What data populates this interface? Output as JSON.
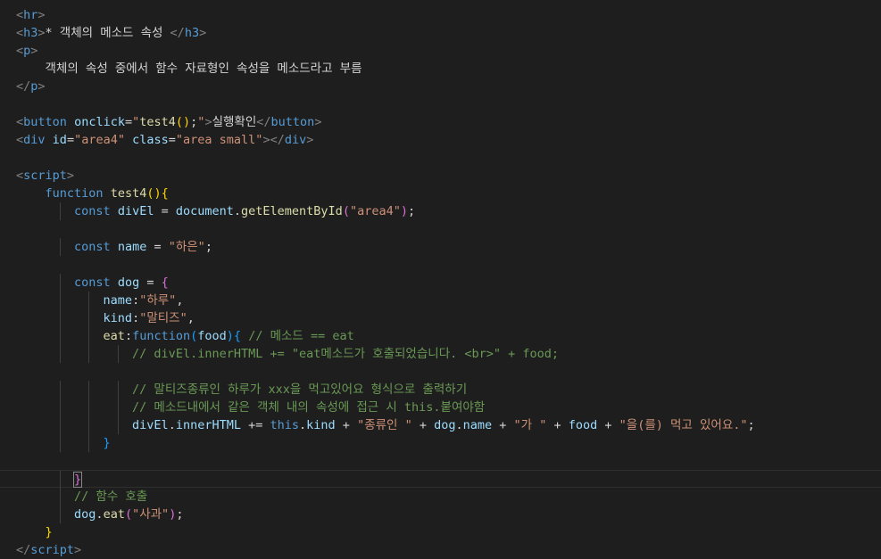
{
  "editor": {
    "lines": [
      [
        [
          "t",
          "<"
        ],
        [
          "tg",
          "hr"
        ],
        [
          "t",
          ">"
        ]
      ],
      [
        [
          "t",
          "<"
        ],
        [
          "tg",
          "h3"
        ],
        [
          "t",
          ">"
        ],
        [
          "tx",
          "* 객체의 메소드 속성 "
        ],
        [
          "t",
          "</"
        ],
        [
          "tg",
          "h3"
        ],
        [
          "t",
          ">"
        ]
      ],
      [
        [
          "t",
          "<"
        ],
        [
          "tg",
          "p"
        ],
        [
          "t",
          ">"
        ]
      ],
      [
        [
          "tx",
          "    객체의 속성 중에서 함수 자료형인 속성을 메소드라고 부름"
        ]
      ],
      [
        [
          "t",
          "</"
        ],
        [
          "tg",
          "p"
        ],
        [
          "t",
          ">"
        ]
      ],
      [],
      [
        [
          "t",
          "<"
        ],
        [
          "tg",
          "button"
        ],
        [
          "tx",
          " "
        ],
        [
          "at",
          "onclick"
        ],
        [
          "tx",
          "="
        ],
        [
          "st",
          "\""
        ],
        [
          "fn",
          "test4"
        ],
        [
          "br1",
          "()"
        ],
        [
          "tx",
          ";"
        ],
        [
          "st",
          "\""
        ],
        [
          "t",
          ">"
        ],
        [
          "tx",
          "실행확인"
        ],
        [
          "t",
          "</"
        ],
        [
          "tg",
          "button"
        ],
        [
          "t",
          ">"
        ]
      ],
      [
        [
          "t",
          "<"
        ],
        [
          "tg",
          "div"
        ],
        [
          "tx",
          " "
        ],
        [
          "at",
          "id"
        ],
        [
          "tx",
          "="
        ],
        [
          "st",
          "\"area4\""
        ],
        [
          "tx",
          " "
        ],
        [
          "at",
          "class"
        ],
        [
          "tx",
          "="
        ],
        [
          "st",
          "\"area small\""
        ],
        [
          "t",
          "></"
        ],
        [
          "tg",
          "div"
        ],
        [
          "t",
          ">"
        ]
      ],
      [],
      [
        [
          "t",
          "<"
        ],
        [
          "tg",
          "script"
        ],
        [
          "t",
          ">"
        ]
      ],
      [
        [
          "tx",
          "    "
        ],
        [
          "kw",
          "function"
        ],
        [
          "tx",
          " "
        ],
        [
          "fn",
          "test4"
        ],
        [
          "br1",
          "(){"
        ]
      ],
      [
        [
          "tx",
          "        "
        ],
        [
          "kw",
          "const"
        ],
        [
          "tx",
          " "
        ],
        [
          "vr",
          "divEl"
        ],
        [
          "tx",
          " = "
        ],
        [
          "vr",
          "document"
        ],
        [
          "tx",
          "."
        ],
        [
          "fn",
          "getElementById"
        ],
        [
          "br2",
          "("
        ],
        [
          "st",
          "\"area4\""
        ],
        [
          "br2",
          ")"
        ],
        [
          "tx",
          ";"
        ]
      ],
      [],
      [
        [
          "tx",
          "        "
        ],
        [
          "kw",
          "const"
        ],
        [
          "tx",
          " "
        ],
        [
          "vr",
          "name"
        ],
        [
          "tx",
          " = "
        ],
        [
          "st",
          "\"하은\""
        ],
        [
          "tx",
          ";"
        ]
      ],
      [],
      [
        [
          "tx",
          "        "
        ],
        [
          "kw",
          "const"
        ],
        [
          "tx",
          " "
        ],
        [
          "vr",
          "dog"
        ],
        [
          "tx",
          " = "
        ],
        [
          "br2",
          "{"
        ]
      ],
      [
        [
          "tx",
          "            "
        ],
        [
          "vr",
          "name"
        ],
        [
          "tx",
          ":"
        ],
        [
          "st",
          "\"하루\""
        ],
        [
          "tx",
          ","
        ]
      ],
      [
        [
          "tx",
          "            "
        ],
        [
          "vr",
          "kind"
        ],
        [
          "tx",
          ":"
        ],
        [
          "st",
          "\"말티즈\""
        ],
        [
          "tx",
          ","
        ]
      ],
      [
        [
          "tx",
          "            "
        ],
        [
          "fn",
          "eat"
        ],
        [
          "tx",
          ":"
        ],
        [
          "kw",
          "function"
        ],
        [
          "br3",
          "("
        ],
        [
          "vr",
          "food"
        ],
        [
          "br3",
          ")"
        ],
        [
          "br3",
          "{"
        ],
        [
          "tx",
          " "
        ],
        [
          "cm",
          "// 메소드 == eat"
        ]
      ],
      [
        [
          "tx",
          "                "
        ],
        [
          "cm",
          "// divEl.innerHTML += \"eat메소드가 호출되었습니다. <br>\" + food;"
        ]
      ],
      [],
      [
        [
          "tx",
          "                "
        ],
        [
          "cm",
          "// 말티즈종류인 하루가 xxx을 먹고있어요 형식으로 출력하기"
        ]
      ],
      [
        [
          "tx",
          "                "
        ],
        [
          "cm",
          "// 메소드내에서 같은 객체 내의 속성에 접근 시 this.붙여야함"
        ]
      ],
      [
        [
          "tx",
          "                "
        ],
        [
          "vr",
          "divEl"
        ],
        [
          "tx",
          "."
        ],
        [
          "vr",
          "innerHTML"
        ],
        [
          "tx",
          " += "
        ],
        [
          "kw",
          "this"
        ],
        [
          "tx",
          "."
        ],
        [
          "vr",
          "kind"
        ],
        [
          "tx",
          " + "
        ],
        [
          "st",
          "\"종류인 \""
        ],
        [
          "tx",
          " + "
        ],
        [
          "vr",
          "dog"
        ],
        [
          "tx",
          "."
        ],
        [
          "vr",
          "name"
        ],
        [
          "tx",
          " + "
        ],
        [
          "st",
          "\"가 \""
        ],
        [
          "tx",
          " + "
        ],
        [
          "vr",
          "food"
        ],
        [
          "tx",
          " + "
        ],
        [
          "st",
          "\"을(를) 먹고 있어요.\""
        ],
        [
          "tx",
          ";"
        ]
      ],
      [
        [
          "tx",
          "            "
        ],
        [
          "br3",
          "}"
        ]
      ],
      [],
      [
        [
          "tx",
          "        "
        ],
        [
          "br2",
          "}"
        ]
      ],
      [
        [
          "tx",
          "        "
        ],
        [
          "cm",
          "// 함수 호출"
        ]
      ],
      [
        [
          "tx",
          "        "
        ],
        [
          "vr",
          "dog"
        ],
        [
          "tx",
          "."
        ],
        [
          "fn",
          "eat"
        ],
        [
          "br2",
          "("
        ],
        [
          "st",
          "\"사과\""
        ],
        [
          "br2",
          ")"
        ],
        [
          "tx",
          ";"
        ]
      ],
      [
        [
          "tx",
          "    "
        ],
        [
          "br1",
          "}"
        ]
      ],
      [
        [
          "t",
          "</"
        ],
        [
          "tg",
          "script"
        ],
        [
          "t",
          ">"
        ]
      ]
    ]
  }
}
